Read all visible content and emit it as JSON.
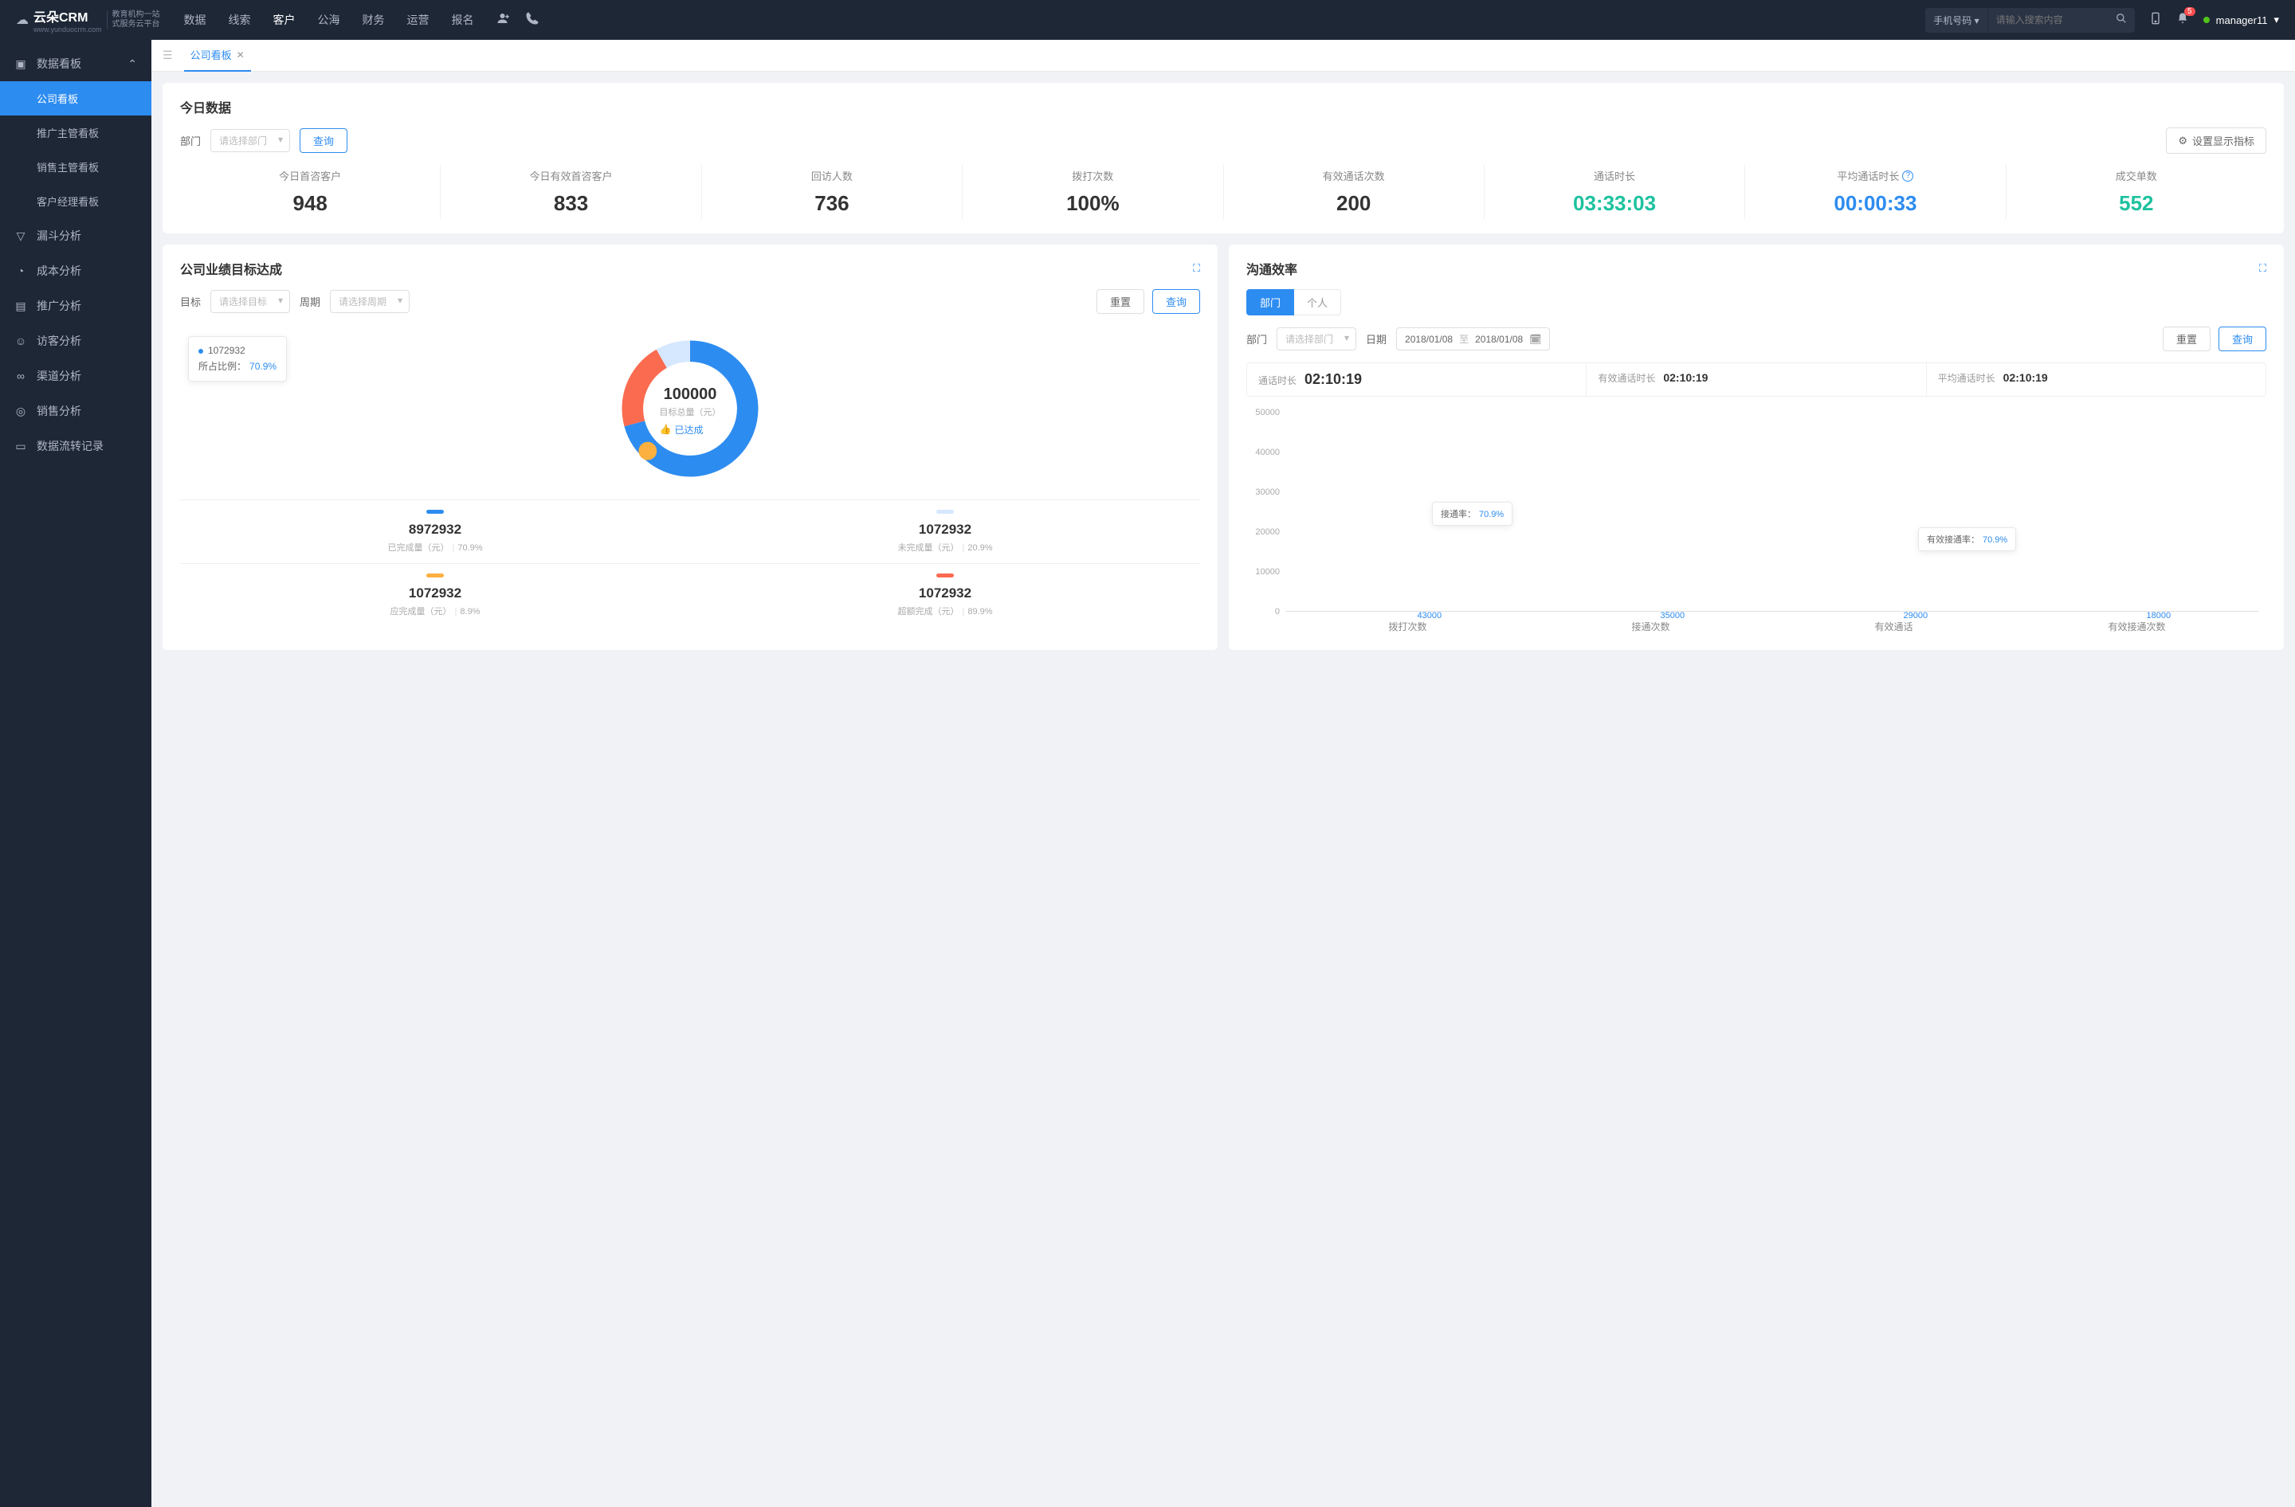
{
  "brand": {
    "name": "云朵CRM",
    "sub_l1": "教育机构一站",
    "sub_l2": "式服务云平台",
    "url": "www.yunduocrm.com"
  },
  "nav": {
    "items": [
      "数据",
      "线索",
      "客户",
      "公海",
      "财务",
      "运营",
      "报名"
    ],
    "active_index": 2
  },
  "search": {
    "type": "手机号码",
    "placeholder": "请输入搜索内容"
  },
  "notif_count": "5",
  "user": {
    "name": "manager11"
  },
  "sidebar": {
    "group": {
      "label": "数据看板",
      "children": [
        "公司看板",
        "推广主管看板",
        "销售主管看板",
        "客户经理看板"
      ],
      "active_index": 0
    },
    "items": [
      "漏斗分析",
      "成本分析",
      "推广分析",
      "访客分析",
      "渠道分析",
      "销售分析",
      "数据流转记录"
    ]
  },
  "tabs": {
    "current": "公司看板"
  },
  "today": {
    "title": "今日数据",
    "dept_label": "部门",
    "dept_placeholder": "请选择部门",
    "query": "查询",
    "settings": "设置显示指标",
    "metrics": [
      {
        "label": "今日首咨客户",
        "value": "948",
        "cls": ""
      },
      {
        "label": "今日有效首咨客户",
        "value": "833",
        "cls": ""
      },
      {
        "label": "回访人数",
        "value": "736",
        "cls": ""
      },
      {
        "label": "拨打次数",
        "value": "100%",
        "cls": ""
      },
      {
        "label": "有效通话次数",
        "value": "200",
        "cls": ""
      },
      {
        "label": "通话时长",
        "value": "03:33:03",
        "cls": "green"
      },
      {
        "label": "平均通话时长",
        "value": "00:00:33",
        "cls": "blue",
        "info": true
      },
      {
        "label": "成交单数",
        "value": "552",
        "cls": "green"
      }
    ]
  },
  "goal": {
    "title": "公司业绩目标达成",
    "target_label": "目标",
    "target_ph": "请选择目标",
    "period_label": "周期",
    "period_ph": "请选择周期",
    "reset": "重置",
    "query": "查询",
    "tooltip_value": "1072932",
    "tooltip_pct_label": "所占比例：",
    "tooltip_pct": "70.9%",
    "center_value": "100000",
    "center_label": "目标总量（元）",
    "status": "已达成",
    "legend": [
      {
        "color": "#2d8cf0",
        "value": "8972932",
        "label": "已完成量（元）",
        "pct": "70.9%"
      },
      {
        "color": "#d6e8ff",
        "value": "1072932",
        "label": "未完成量（元）",
        "pct": "20.9%"
      },
      {
        "color": "#fcb040",
        "value": "1072932",
        "label": "应完成量（元）",
        "pct": "8.9%"
      },
      {
        "color": "#fa6b4f",
        "value": "1072932",
        "label": "超额完成（元）",
        "pct": "89.9%"
      }
    ]
  },
  "comm": {
    "title": "沟通效率",
    "toggle": {
      "dept": "部门",
      "person": "个人"
    },
    "dept_label": "部门",
    "dept_ph": "请选择部门",
    "date_label": "日期",
    "date_from": "2018/01/08",
    "date_to": "2018/01/08",
    "date_sep": "至",
    "reset": "重置",
    "query": "查询",
    "durations": [
      {
        "label": "通话时长",
        "value": "02:10:19",
        "big": true
      },
      {
        "label": "有效通话时长",
        "value": "02:10:19"
      },
      {
        "label": "平均通话时长",
        "value": "02:10:19"
      }
    ],
    "tips": [
      {
        "label": "接通率：",
        "pct": "70.9%"
      },
      {
        "label": "有效接通率：",
        "pct": "70.9%"
      }
    ]
  },
  "chart_data": {
    "type": "bar",
    "categories": [
      "拨打次数",
      "接通次数",
      "有效通话",
      "有效接通次数"
    ],
    "values": [
      43000,
      35000,
      29000,
      18000
    ],
    "ylabel": "",
    "xlabel": "",
    "ylim": [
      0,
      50000
    ],
    "y_ticks": [
      0,
      10000,
      20000,
      30000,
      40000,
      50000
    ]
  }
}
